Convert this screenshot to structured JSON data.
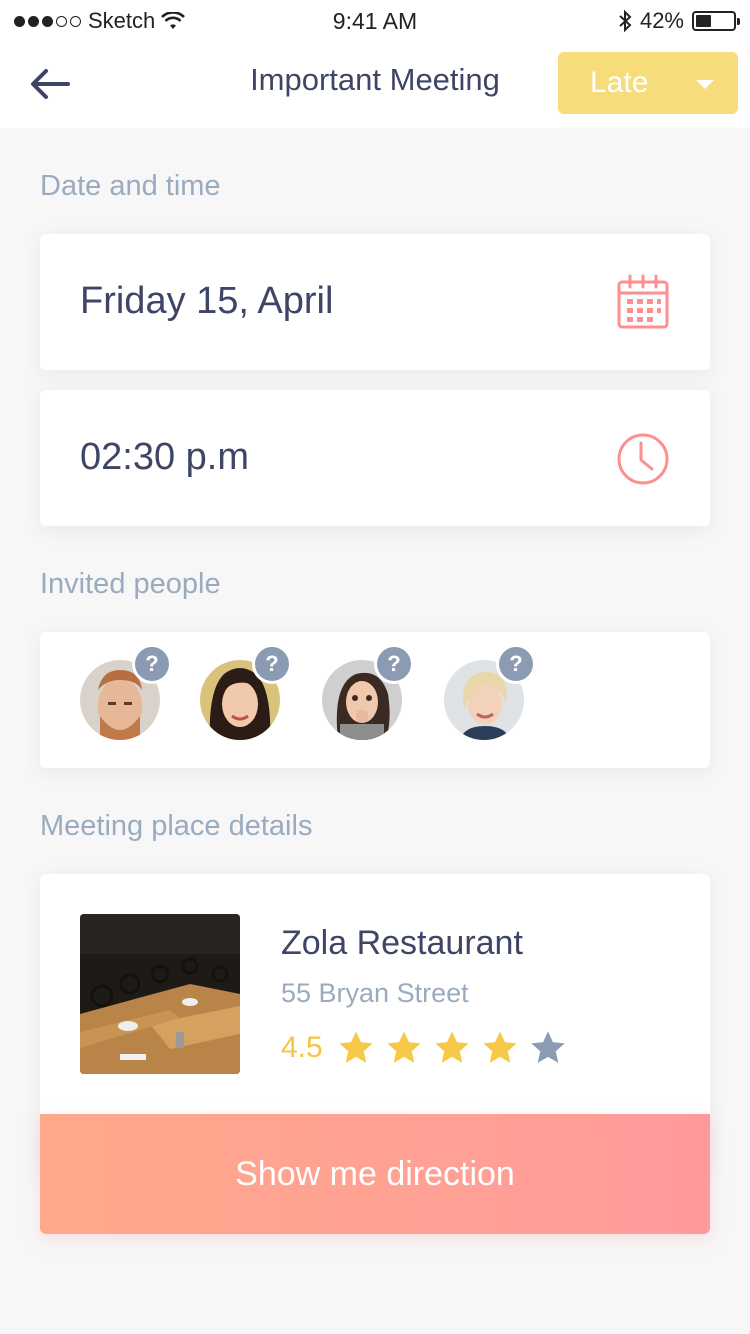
{
  "status_bar": {
    "carrier": "Sketch",
    "time": "9:41 AM",
    "battery": "42%",
    "battery_level": 0.42,
    "signal_dots_filled": 3,
    "signal_dots_total": 5
  },
  "nav": {
    "title": "Important Meeting",
    "back_icon": "back-arrow-icon",
    "status_value": "Late",
    "status_color": "#f7dc7b"
  },
  "date_time": {
    "section_label": "Date and time",
    "date": "Friday 15, April",
    "time": "02:30 p.m",
    "icon_color": "#ff8f8f"
  },
  "invited": {
    "section_label": "Invited people",
    "people": [
      {
        "badge": "?"
      },
      {
        "badge": "?"
      },
      {
        "badge": "?"
      },
      {
        "badge": "?"
      }
    ]
  },
  "place": {
    "section_label": "Meeting place details",
    "name": "Zola Restaurant",
    "address": "55 Bryan Street",
    "rating": "4.5",
    "stars_filled": 4,
    "stars_total": 5,
    "star_color": "#f7c948",
    "star_empty_color": "#8b9bb4"
  },
  "action": {
    "label": "Show me direction"
  }
}
